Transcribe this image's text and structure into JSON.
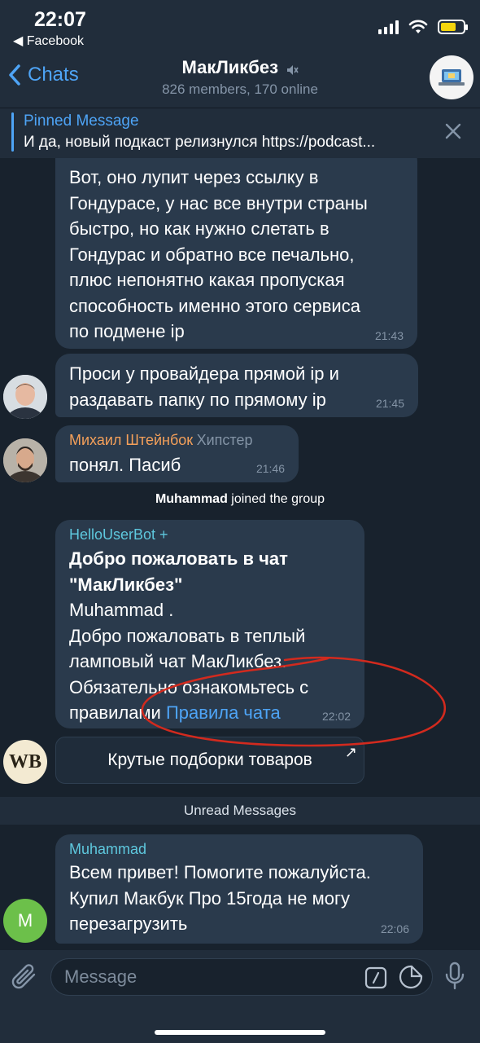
{
  "status_bar": {
    "time": "22:07",
    "back_app": "◀ Facebook",
    "battery_color": "#f5d50d"
  },
  "header": {
    "back_label": "Chats",
    "title": "МакЛикбез",
    "subtitle": "826 members, 170 online",
    "muted": true
  },
  "pinned": {
    "title": "Pinned Message",
    "text": "И да, новый подкаст релизнулся https://podcast..."
  },
  "messages": [
    {
      "lines": [
        "Вот, оно лупит через ссылку в",
        "Гондурасе, у нас все внутри страны",
        "быстро, но как нужно слетать в",
        "Гондурас и обратно все печально,",
        "плюс непонятно какая пропуская",
        "способность именно этого сервиса",
        "по подмене ip"
      ],
      "time": "21:43"
    },
    {
      "lines": [
        "Проси у провайдера прямой ip и",
        "раздавать папку по прямому ip"
      ],
      "time": "21:45"
    },
    {
      "sender": "Михаил Штейнбок",
      "sender_title": "Хипстер",
      "sender_color": "#f5a05a",
      "lines": [
        "понял. Пасиб"
      ],
      "time": "21:46"
    }
  ],
  "service_join": {
    "name": "Muhammad",
    "text": " joined the group"
  },
  "bot_message": {
    "sender": "HelloUserBot +",
    "sender_color": "#5ec8de",
    "bold_lines": [
      "Добро пожаловать в чат",
      "\"МакЛикбез\""
    ],
    "lines": [
      "Muhammad .",
      "Добро пожаловать в теплый",
      "ламповый чат МакЛикбез.",
      "Обязательно ознакомьтесь с"
    ],
    "last_line_prefix": "правилами ",
    "link": "Правила чата",
    "time": "22:02",
    "avatar_text": "WB",
    "button_label": "Крутые подборки товаров",
    "button_arrow": "↗"
  },
  "unread_label": "Unread Messages",
  "last_message": {
    "sender": "Muhammad",
    "sender_color": "#5ec8de",
    "avatar_letter": "M",
    "avatar_color": "#6cc04a",
    "lines": [
      "Всем привет! Помогите пожалуйста.",
      "Купил Макбук Про 15года не могу",
      "перезагрузить"
    ],
    "time": "22:06"
  },
  "input": {
    "placeholder": "Message"
  },
  "colors": {
    "accent": "#4ea4f6",
    "bubble": "#2a3a4c",
    "background": "#18222d",
    "annotation": "#d22a1e"
  }
}
